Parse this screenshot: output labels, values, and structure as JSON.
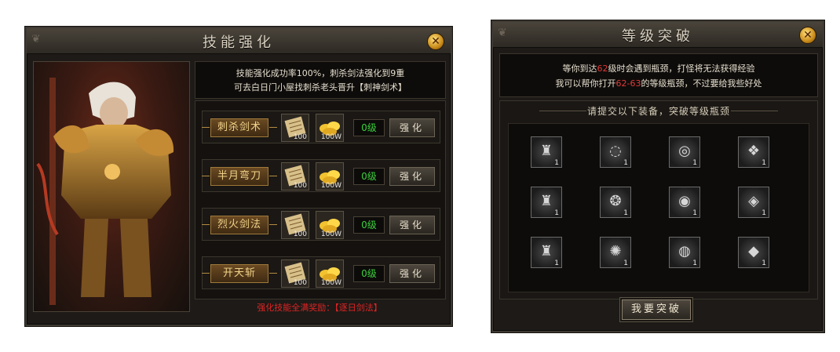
{
  "skill_panel": {
    "title": "技能强化",
    "close_glyph": "✕",
    "description": {
      "line1": "技能强化成功率100%，刺杀剑法强化到9重",
      "line2": "可去白日门小屋找刺杀老头晋升【刺神剑术】"
    },
    "rows": [
      {
        "name": "刺杀剑术",
        "scroll_count": "100",
        "gold_count": "100W",
        "level": "0级",
        "button": "强化"
      },
      {
        "name": "半月弯刀",
        "scroll_count": "100",
        "gold_count": "100W",
        "level": "0级",
        "button": "强化"
      },
      {
        "name": "烈火剑法",
        "scroll_count": "100",
        "gold_count": "100W",
        "level": "0级",
        "button": "强化"
      },
      {
        "name": "开天斩",
        "scroll_count": "100",
        "gold_count": "100W",
        "level": "0级",
        "button": "强化"
      }
    ],
    "reward_text": "强化技能全满奖励：【逐日剑法】",
    "colors": {
      "level_text": "#3ccf3c",
      "reward_text": "#e02424",
      "skill_name": "#f0d38a"
    }
  },
  "break_panel": {
    "title": "等级突破",
    "close_glyph": "✕",
    "info": {
      "l1_a": "等你到达",
      "l1_num": "62",
      "l1_b": "级时会遇到瓶颈，打怪将无法获得经验",
      "l2_a": "我可以帮你打开",
      "l2_range": "62-63",
      "l2_b": "的等级瓶颈，不过要给我些好处"
    },
    "equip_title": "请提交以下装备，突破等级瓶颈",
    "equipment": [
      {
        "icon": "helmet-icon",
        "glyph": "♜",
        "count": "1"
      },
      {
        "icon": "necklace-icon",
        "glyph": "◌",
        "count": "1"
      },
      {
        "icon": "ring-icon",
        "glyph": "◎",
        "count": "1"
      },
      {
        "icon": "bracelet-icon",
        "glyph": "❖",
        "count": "1"
      },
      {
        "icon": "helmet-icon",
        "glyph": "♜",
        "count": "1"
      },
      {
        "icon": "necklace-icon",
        "glyph": "❂",
        "count": "1"
      },
      {
        "icon": "ring-icon",
        "glyph": "◉",
        "count": "1"
      },
      {
        "icon": "bracelet-icon",
        "glyph": "◈",
        "count": "1"
      },
      {
        "icon": "helmet-icon",
        "glyph": "♜",
        "count": "1"
      },
      {
        "icon": "necklace-icon",
        "glyph": "✺",
        "count": "1"
      },
      {
        "icon": "ring-icon",
        "glyph": "◍",
        "count": "1"
      },
      {
        "icon": "bracelet-icon",
        "glyph": "◆",
        "count": "1"
      }
    ],
    "submit_button": "我要突破",
    "colors": {
      "highlight": "#e03a3a"
    }
  }
}
